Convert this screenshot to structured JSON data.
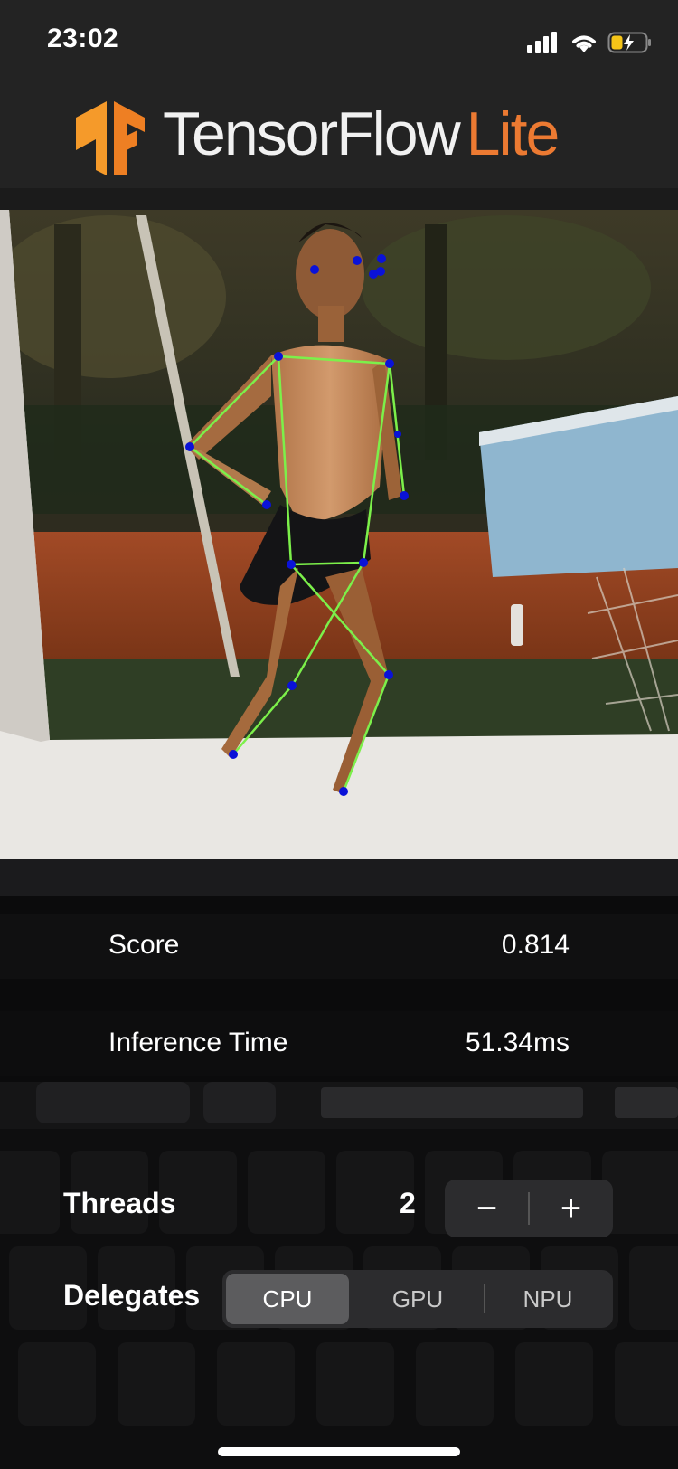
{
  "status_bar": {
    "time": "23:02",
    "icons": [
      "cellular-signal-icon",
      "wifi-icon",
      "battery-charging-icon"
    ],
    "battery_color": "#f5c518"
  },
  "header": {
    "logo_icon": "tensorflow-logo-icon",
    "brand_main": "TensorFlow",
    "brand_accent": "Lite",
    "accent_color": "#ec7a32"
  },
  "camera": {
    "overlay_keypoint_color": "#0a12d8",
    "overlay_line_color": "#7cf04a"
  },
  "results": {
    "score_label": "Score",
    "score_value": "0.814",
    "inference_label": "Inference Time",
    "inference_value": "51.34ms"
  },
  "controls": {
    "threads_label": "Threads",
    "threads_value": "2",
    "decrement_symbol": "−",
    "increment_symbol": "+",
    "delegates_label": "Delegates",
    "delegates": [
      "CPU",
      "GPU",
      "NPU"
    ],
    "selected_delegate": "CPU"
  }
}
